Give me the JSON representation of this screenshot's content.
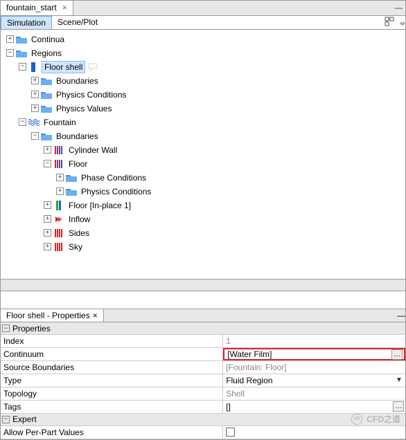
{
  "top_tab": {
    "label": "fountain_start"
  },
  "section_tabs": {
    "simulation": "Simulation",
    "scene": "Scene/Plot"
  },
  "tree": {
    "continua": "Continua",
    "regions": "Regions",
    "floor_shell": "Floor shell",
    "boundaries": "Boundaries",
    "physics_conditions": "Physics Conditions",
    "physics_values": "Physics Values",
    "fountain": "Fountain",
    "cylinder_wall": "Cylinder Wall",
    "floor": "Floor",
    "phase_conditions": "Phase Conditions",
    "floor_inplace": "Floor [In-place 1]",
    "inflow": "Inflow",
    "sides": "Sides",
    "sky": "Sky"
  },
  "props_title": "Floor shell - Properties",
  "groups": {
    "properties": "Properties",
    "expert": "Expert"
  },
  "props": {
    "index_k": "Index",
    "index_v": "1",
    "continuum_k": "Continuum",
    "continuum_v": "[Water Film]",
    "source_k": "Source Boundaries",
    "source_v": "[Fountain: Floor]",
    "type_k": "Type",
    "type_v": "Fluid Region",
    "topology_k": "Topology",
    "topology_v": "Shell",
    "tags_k": "Tags",
    "tags_v": "[]",
    "allow_k": "Allow Per-Part Values"
  },
  "watermark": "CFD之道"
}
